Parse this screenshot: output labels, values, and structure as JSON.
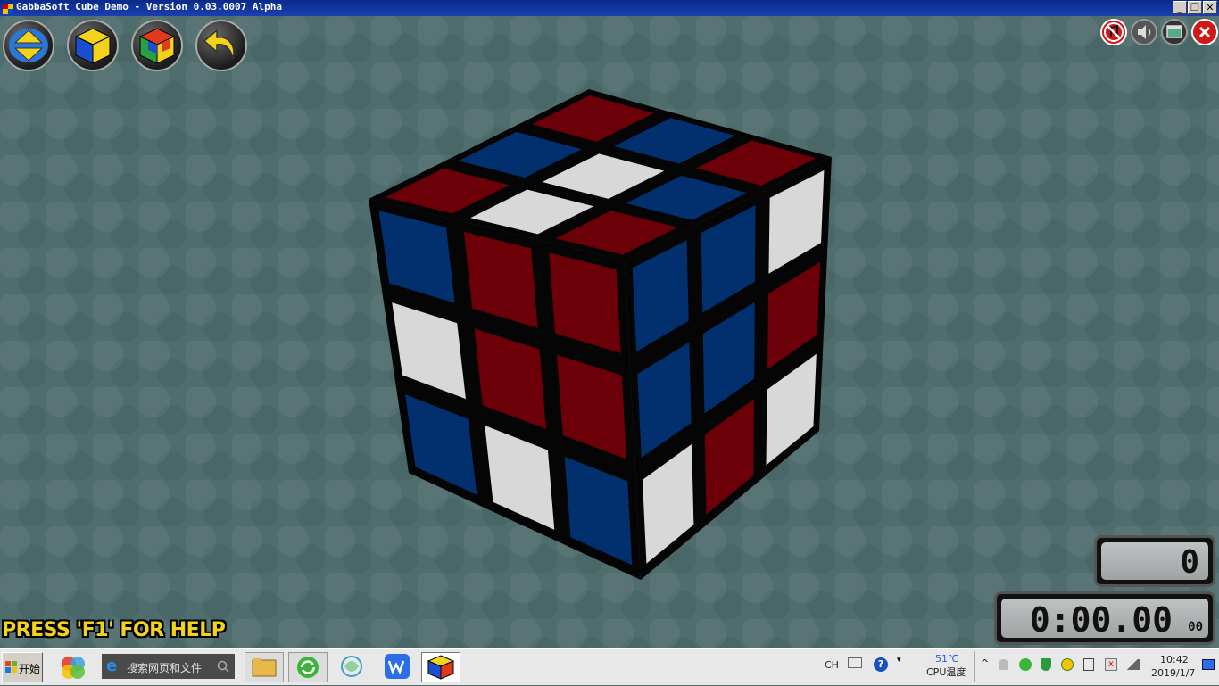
{
  "window": {
    "title": "GabbaSoft Cube Demo - Version 0.03.0007 Alpha",
    "controls": [
      "_",
      "❐",
      "✕"
    ]
  },
  "toolbar": {
    "buttons": [
      "up-down-arrows-icon",
      "cube-solve-icon",
      "cube-scramble-icon",
      "undo-arrow-icon"
    ],
    "right_buttons": [
      "music-off-icon",
      "sound-icon",
      "window-icon",
      "close-icon"
    ]
  },
  "cube": {
    "top": [
      [
        "red",
        "blue",
        "red"
      ],
      [
        "blue",
        "white",
        "blue"
      ],
      [
        "red",
        "white",
        "red"
      ]
    ],
    "front": [
      [
        "blue",
        "red",
        "red"
      ],
      [
        "white",
        "red",
        "red"
      ],
      [
        "blue",
        "white",
        "blue"
      ]
    ],
    "right": [
      [
        "blue",
        "blue",
        "white"
      ],
      [
        "blue",
        "blue",
        "red"
      ],
      [
        "white",
        "red",
        "white"
      ]
    ],
    "colors": {
      "red": "#6b0008",
      "blue": "#02306e",
      "white": "#d8d8d8"
    }
  },
  "help_text": "PRESS 'F1' FOR HELP",
  "move_counter": "0",
  "timer": {
    "main": "0:00.00",
    "hundredths": "00"
  },
  "taskbar": {
    "start_label": "开始",
    "search_placeholder": "搜索网页和文件",
    "lang": "CH",
    "cpu_temp": "51℃",
    "cpu_label": "CPU温度",
    "time": "10:42",
    "date": "2019/1/7"
  }
}
